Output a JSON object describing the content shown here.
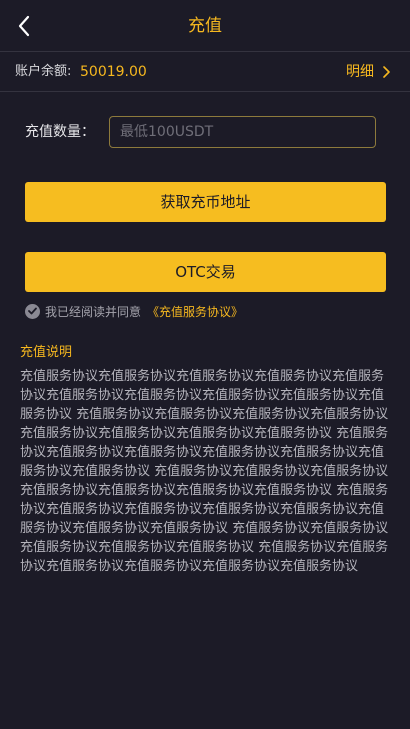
{
  "header": {
    "title": "充值",
    "back_icon": "chevron-left-icon"
  },
  "balance": {
    "label": "账户余额:",
    "value": "50019.00",
    "detail_label": "明细",
    "detail_icon": "chevron-right-icon"
  },
  "form": {
    "amount_label": "充值数量：",
    "amount_placeholder": "最低100USDT",
    "amount_value": ""
  },
  "buttons": {
    "get_address": "获取充币地址",
    "otc": "OTC交易"
  },
  "agreement": {
    "checked": true,
    "text": "我已经阅读并同意",
    "link": "《充值服务协议》"
  },
  "description": {
    "title": "充值说明",
    "body": "充值服务协议充值服务协议充值服务协议充值服务协议充值服务协议充值服务协议充值服务协议充值服务协议充值服务协议充值服务协议 充值服务协议充值服务协议充值服务协议充值服务协议充值服务协议充值服务协议充值服务协议充值服务协议 充值服务协议充值服务协议充值服务协议充值服务协议充值服务协议充值服务协议充值服务协议 充值服务协议充值服务协议充值服务协议充值服务协议充值服务协议充值服务协议充值服务协议 充值服务协议充值服务协议充值服务协议充值服务协议充值服务协议充值服务协议充值服务协议充值服务协议 充值服务协议充值服务协议充值服务协议充值服务协议充值服务协议 充值服务协议充值服务协议充值服务协议充值服务协议充值服务协议充值服务协议"
  },
  "colors": {
    "background": "#1c1b27",
    "accent": "#f6b81f",
    "button": "#f6bd20",
    "input_border": "#8d7a3c"
  }
}
